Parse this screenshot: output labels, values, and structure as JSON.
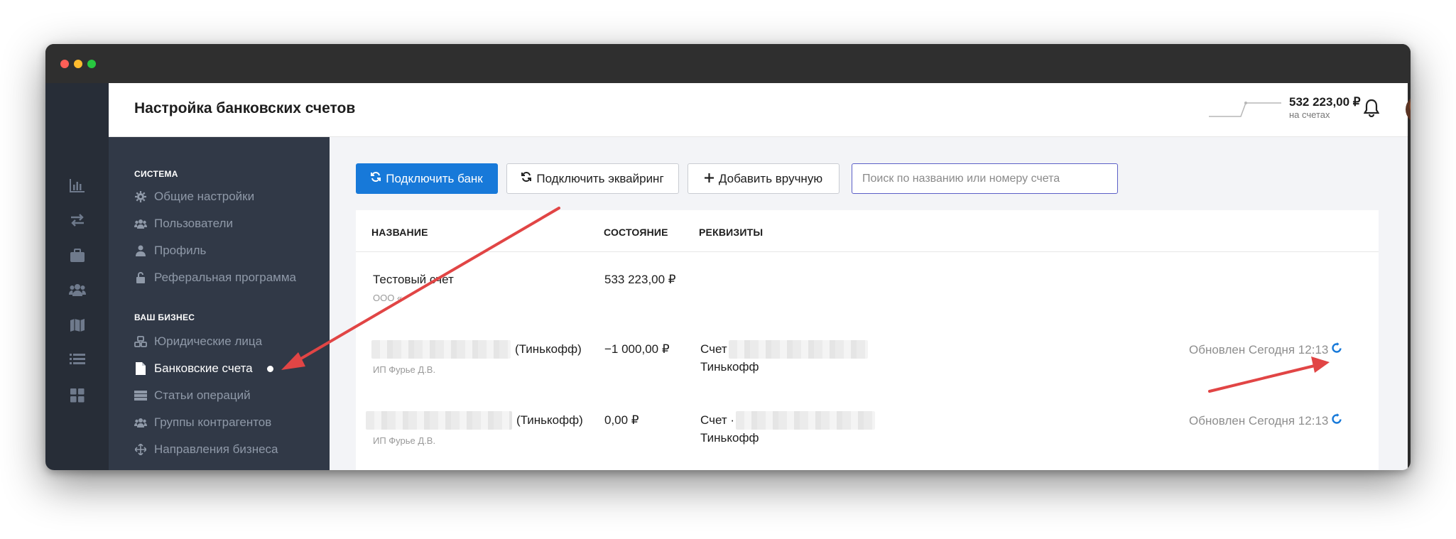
{
  "header": {
    "title": "Настройка банковских счетов",
    "balance": "532 223,00 ₽",
    "balance_caption": "на счетах"
  },
  "icons": {
    "rail": [
      "chart-icon",
      "transfer-icon",
      "briefcase-icon",
      "users-icon",
      "map-icon",
      "list-icon",
      "grid-icon"
    ]
  },
  "sidebar": {
    "section_system": "СИСТЕМА",
    "system_items": [
      {
        "label": "Общие настройки",
        "icon": "gear-icon"
      },
      {
        "label": "Пользователи",
        "icon": "users-icon"
      },
      {
        "label": "Профиль",
        "icon": "user-icon"
      },
      {
        "label": "Реферальная программа",
        "icon": "unlock-icon"
      }
    ],
    "section_business": "ВАШ БИЗНЕС",
    "business_items": [
      {
        "label": "Юридические лица",
        "icon": "cubes-icon"
      },
      {
        "label": "Банковские счета",
        "icon": "file-icon",
        "active": true
      },
      {
        "label": "Статьи операций",
        "icon": "server-icon"
      },
      {
        "label": "Группы контрагентов",
        "icon": "users-icon"
      },
      {
        "label": "Направления бизнеса",
        "icon": "arrows-icon"
      }
    ]
  },
  "toolbar": {
    "connect_bank": "Подключить банк",
    "connect_acquiring": "Подключить эквайринг",
    "add_manual": "Добавить вручную",
    "search_placeholder": "Поиск по названию или номеру счета"
  },
  "table": {
    "columns": [
      "НАЗВАНИЕ",
      "СОСТОЯНИЕ",
      "РЕКВИЗИТЫ"
    ],
    "rows": [
      {
        "name": "Тестовый счет",
        "owner": "ООО «",
        "balance": "533 223,00 ₽",
        "details_prefix": "",
        "details_bank": "",
        "updated": ""
      },
      {
        "name_suffix": "(Тинькофф)",
        "owner": "ИП Фурье Д.В.",
        "balance": "−1 000,00 ₽",
        "details_prefix": "Счет",
        "details_bank": "Тинькофф",
        "updated": "Обновлен Сегодня 12:13"
      },
      {
        "name_suffix": "(Тинькофф)",
        "owner": "ИП Фурье Д.В.",
        "balance": "0,00 ₽",
        "details_prefix": "Счет ·",
        "details_bank": "Тинькофф",
        "updated": "Обновлен Сегодня 12:13"
      }
    ]
  },
  "colors": {
    "primary": "#1779d9",
    "sidebar": "#313947",
    "rail": "#272d37",
    "annotation_arrow": "#e14545"
  }
}
